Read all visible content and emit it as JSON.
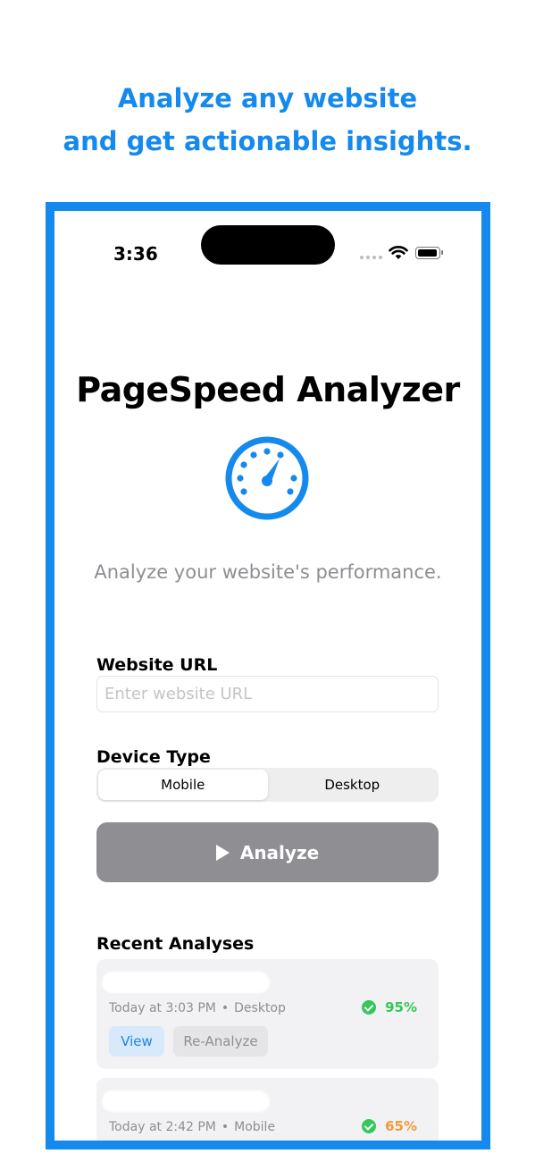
{
  "headline": {
    "line1": "Analyze any website",
    "line2": "and get actionable insights."
  },
  "colors": {
    "brand": "#1489ee",
    "button_disabled": "#8e8e93",
    "success": "#34c759",
    "warning": "#f29a38"
  },
  "status_bar": {
    "time": "3:36"
  },
  "app": {
    "title": "PageSpeed Analyzer",
    "icon": "speedometer-icon",
    "subtitle": "Analyze your website's performance."
  },
  "form": {
    "url_label": "Website URL",
    "url_placeholder": "Enter website URL",
    "url_value": "",
    "device_label": "Device Type",
    "device_options": [
      "Mobile",
      "Desktop"
    ],
    "device_selected": "Mobile",
    "analyze_label": "Analyze"
  },
  "recent": {
    "title": "Recent Analyses",
    "items": [
      {
        "time": "Today at 3:03 PM",
        "separator": "•",
        "device": "Desktop",
        "score": "95%",
        "score_color": "#34c759",
        "view_label": "View",
        "reanalyze_label": "Re-Analyze"
      },
      {
        "time": "Today at 2:42 PM",
        "separator": "•",
        "device": "Mobile",
        "score": "65%",
        "score_color": "#f29a38"
      }
    ]
  }
}
